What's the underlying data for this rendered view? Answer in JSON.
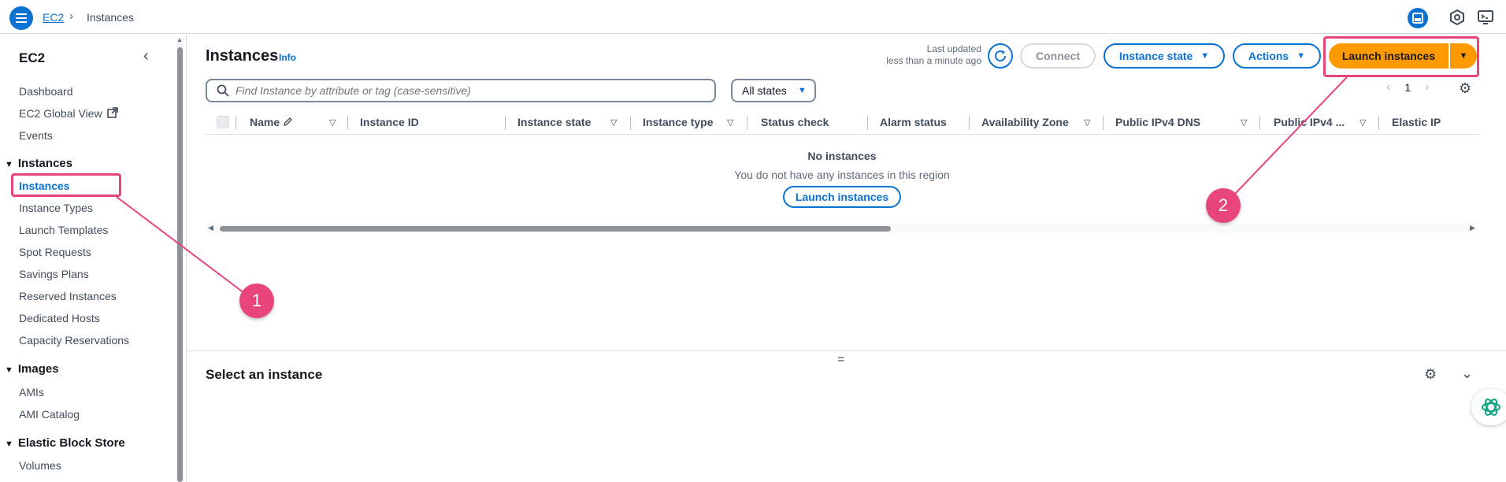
{
  "breadcrumb": {
    "root": "EC2",
    "current": "Instances"
  },
  "sidebar": {
    "title": "EC2",
    "top_links": [
      "Dashboard",
      "EC2 Global View",
      "Events"
    ],
    "sections": [
      {
        "label": "Instances",
        "items": [
          "Instances",
          "Instance Types",
          "Launch Templates",
          "Spot Requests",
          "Savings Plans",
          "Reserved Instances",
          "Dedicated Hosts",
          "Capacity Reservations"
        ]
      },
      {
        "label": "Images",
        "items": [
          "AMIs",
          "AMI Catalog"
        ]
      },
      {
        "label": "Elastic Block Store",
        "items": [
          "Volumes"
        ]
      }
    ],
    "active_item": "Instances"
  },
  "header": {
    "title": "Instances",
    "info": "Info",
    "last_updated_label": "Last updated",
    "last_updated_value": "less than a minute ago",
    "connect": "Connect",
    "instance_state": "Instance state",
    "actions": "Actions",
    "launch": "Launch instances"
  },
  "filter": {
    "placeholder": "Find Instance by attribute or tag (case-sensitive)",
    "state": "All states"
  },
  "pagination": {
    "page": "1"
  },
  "table": {
    "columns": [
      "Name",
      "Instance ID",
      "Instance state",
      "Instance type",
      "Status check",
      "Alarm status",
      "Availability Zone",
      "Public IPv4 DNS",
      "Public IPv4 ...",
      "Elastic IP"
    ],
    "empty_title": "No instances",
    "empty_desc": "You do not have any instances in this region",
    "empty_action": "Launch instances"
  },
  "details": {
    "title": "Select an instance"
  },
  "annotations": {
    "callout_1": "1",
    "callout_2": "2",
    "color": "#e8457a"
  },
  "colors": {
    "accent": "#0972d3",
    "primary_button": "#ff9900",
    "annotation": "#e8457a"
  }
}
